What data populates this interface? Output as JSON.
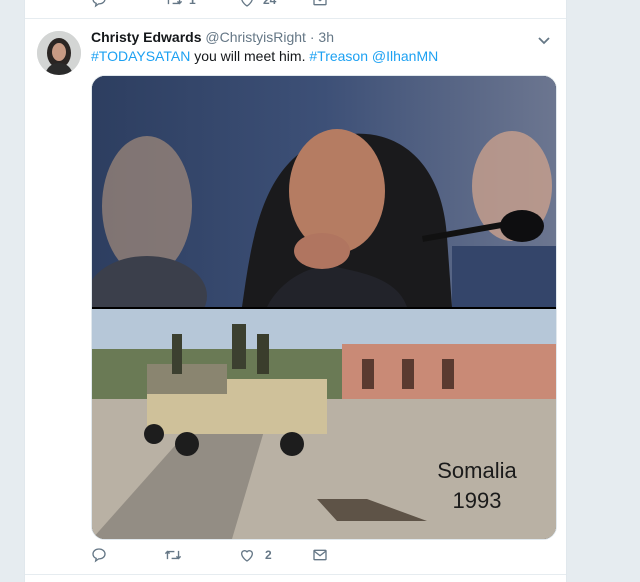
{
  "previous_tweet": {
    "retweets": "1",
    "likes": "24"
  },
  "tweet": {
    "display_name": "Christy Edwards",
    "handle": "@ChristyisRight",
    "separator": "·",
    "time": "3h",
    "text_parts": [
      {
        "type": "hashtag",
        "text": "#TODAYSATAN"
      },
      {
        "type": "plain",
        "text": " you will meet him. "
      },
      {
        "type": "hashtag",
        "text": "#Treason"
      },
      {
        "type": "plain",
        "text": " "
      },
      {
        "type": "mention",
        "text": "@IlhanMN"
      }
    ],
    "media": {
      "overlay_line1": "Somalia",
      "overlay_line2": "1993"
    },
    "actions": {
      "replies": "",
      "retweets": "",
      "likes": "2"
    }
  },
  "colors": {
    "accent": "#1da1f2",
    "muted": "#657786",
    "text": "#14171a",
    "background": "#e6ecf0"
  },
  "icons": [
    "reply-icon",
    "retweet-icon",
    "like-icon",
    "direct-message-icon",
    "caret-down-icon"
  ]
}
